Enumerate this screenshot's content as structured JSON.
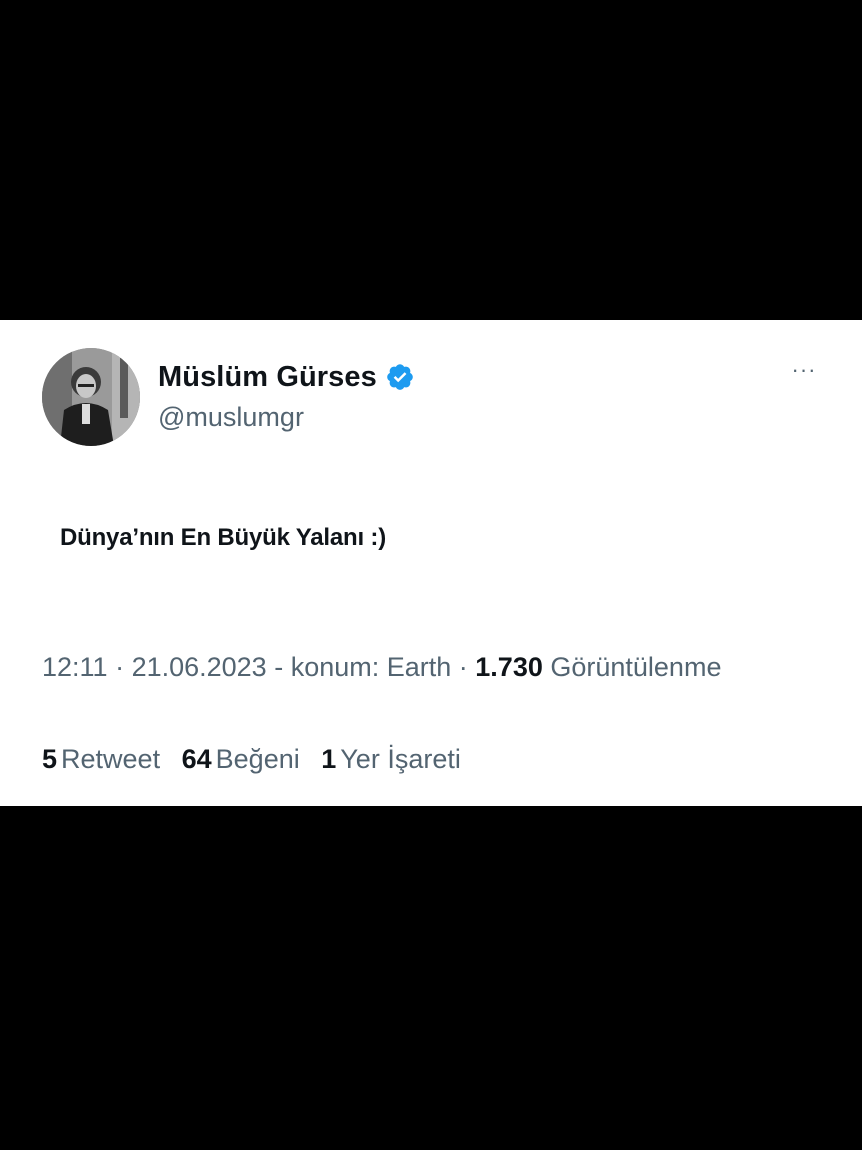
{
  "colors": {
    "background": "#000000",
    "card": "#ffffff",
    "primary_text": "#0f1419",
    "secondary_text": "#536471",
    "verified_blue": "#1d9bf0"
  },
  "tweet": {
    "author": {
      "display_name": "Müslüm Gürses",
      "handle": "@muslumgr",
      "verified_icon": "verified-badge-icon",
      "avatar": "avatar-photo"
    },
    "more_label": "···",
    "text": "Dünya’nın En Büyük Yalanı :)",
    "meta": {
      "time": "12:11",
      "sep1": " · ",
      "date": "21.06.2023",
      "location": " - konum: Earth",
      "sep2": " · ",
      "views_count": "1.730",
      "views_label": " Görüntülenme"
    },
    "stats": {
      "retweets_count": "5",
      "retweets_label": "Retweet",
      "likes_count": "64",
      "likes_label": "Beğeni",
      "bookmarks_count": "1",
      "bookmarks_label": "Yer İşareti"
    }
  }
}
